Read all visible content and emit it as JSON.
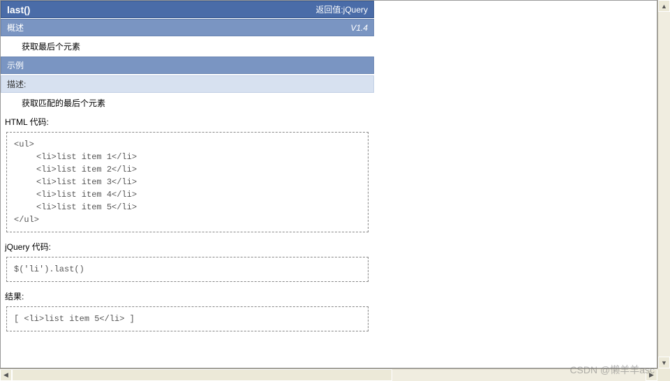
{
  "header": {
    "title": "last()",
    "return_label": "返回值:jQuery"
  },
  "overview": {
    "label": "概述",
    "version": "V1.4",
    "text": "获取最后个元素"
  },
  "example": {
    "label": "示例",
    "desc_label": "描述:",
    "desc_text": "获取匹配的最后个元素",
    "html_label": "HTML 代码:",
    "html_code": {
      "open": "<ul>",
      "items": [
        "<li>list item 1</li>",
        "<li>list item 2</li>",
        "<li>list item 3</li>",
        "<li>list item 4</li>",
        "<li>list item 5</li>"
      ],
      "close": "</ul>"
    },
    "jquery_label": "jQuery 代码:",
    "jquery_code": "$('li').last()",
    "result_label": "结果:",
    "result_code": "[ <li>list item 5</li> ]"
  },
  "watermark": "CSDN @懒羊羊asc"
}
